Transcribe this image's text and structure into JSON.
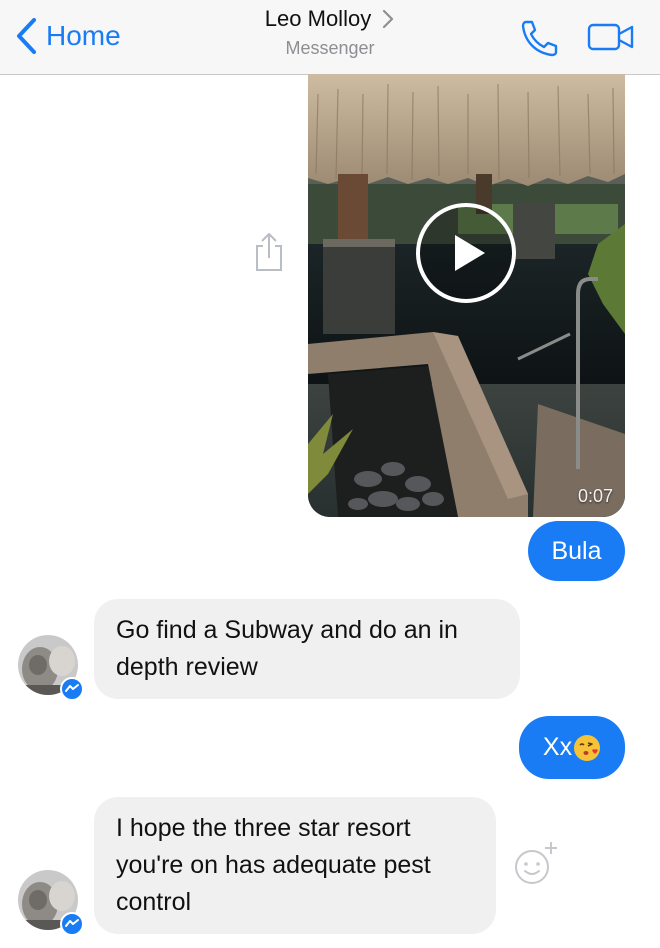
{
  "header": {
    "back_label": "Home",
    "title": "Leo Molloy",
    "subtitle": "Messenger",
    "accent_color": "#1a7cf5",
    "icons": [
      "chevron-left-icon",
      "chevron-right-icon",
      "phone-icon",
      "video-camera-icon"
    ]
  },
  "conversation": {
    "video_message": {
      "duration": "0:07",
      "icons": [
        "play-icon",
        "share-icon"
      ]
    },
    "messages": [
      {
        "direction": "outgoing",
        "text": "Bula"
      },
      {
        "direction": "incoming",
        "text": "Go find a Subway and do an in depth review"
      },
      {
        "direction": "outgoing",
        "text": "Xx",
        "emoji": "kissing-face-emoji"
      },
      {
        "direction": "incoming",
        "text": "I hope the three star resort you're on has adequate pest control"
      }
    ],
    "bubble_colors": {
      "outgoing": "#1a7cf5",
      "incoming": "#f1f0f0"
    },
    "reaction_icon": "add-reaction-icon",
    "messenger_badge_icon": "messenger-badge-icon"
  }
}
